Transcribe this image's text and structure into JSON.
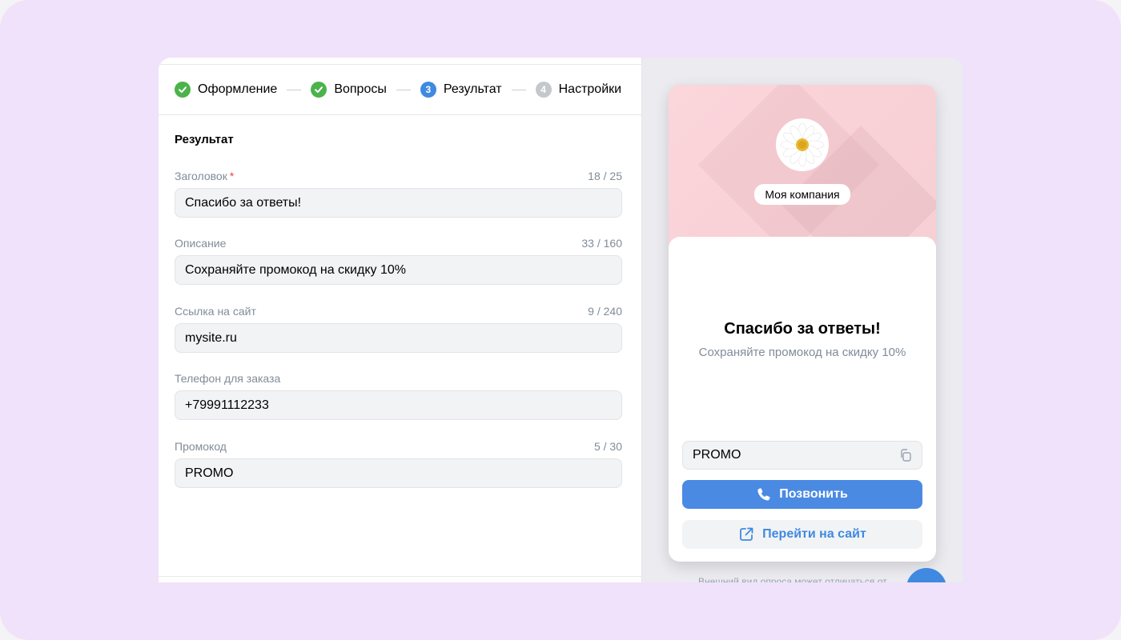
{
  "steps": [
    {
      "label": "Оформление",
      "state": "done"
    },
    {
      "label": "Вопросы",
      "state": "done"
    },
    {
      "label": "Результат",
      "state": "active",
      "number": "3"
    },
    {
      "label": "Настройки",
      "state": "todo",
      "number": "4"
    }
  ],
  "section_title": "Результат",
  "fields": {
    "title": {
      "label": "Заголовок",
      "required_mark": "*",
      "counter": "18 / 25",
      "value": "Спасибо за ответы!"
    },
    "description": {
      "label": "Описание",
      "counter": "33 / 160",
      "value": "Сохраняйте промокод на скидку 10%"
    },
    "site": {
      "label": "Ссылка на сайт",
      "counter": "9 / 240",
      "value": "mysite.ru"
    },
    "phone": {
      "label": "Телефон для заказа",
      "value": "+79991112233"
    },
    "promo": {
      "label": "Промокод",
      "counter": "5 / 30",
      "value": "PROMO"
    }
  },
  "preview": {
    "company": "Моя компания",
    "title": "Спасибо за ответы!",
    "description": "Сохраняйте промокод на скидку 10%",
    "promo": "PROMO",
    "call_button": "Позвонить",
    "site_button": "Перейти на сайт",
    "footnote": "Внешний вид опроса может отличаться от"
  },
  "colors": {
    "accent": "#3f8ae0",
    "done": "#4bb34b",
    "background": "#efe2fa"
  },
  "icons": [
    "check-icon",
    "copy-icon",
    "phone-icon",
    "external-link-icon",
    "chat-icon",
    "daisy-logo"
  ]
}
